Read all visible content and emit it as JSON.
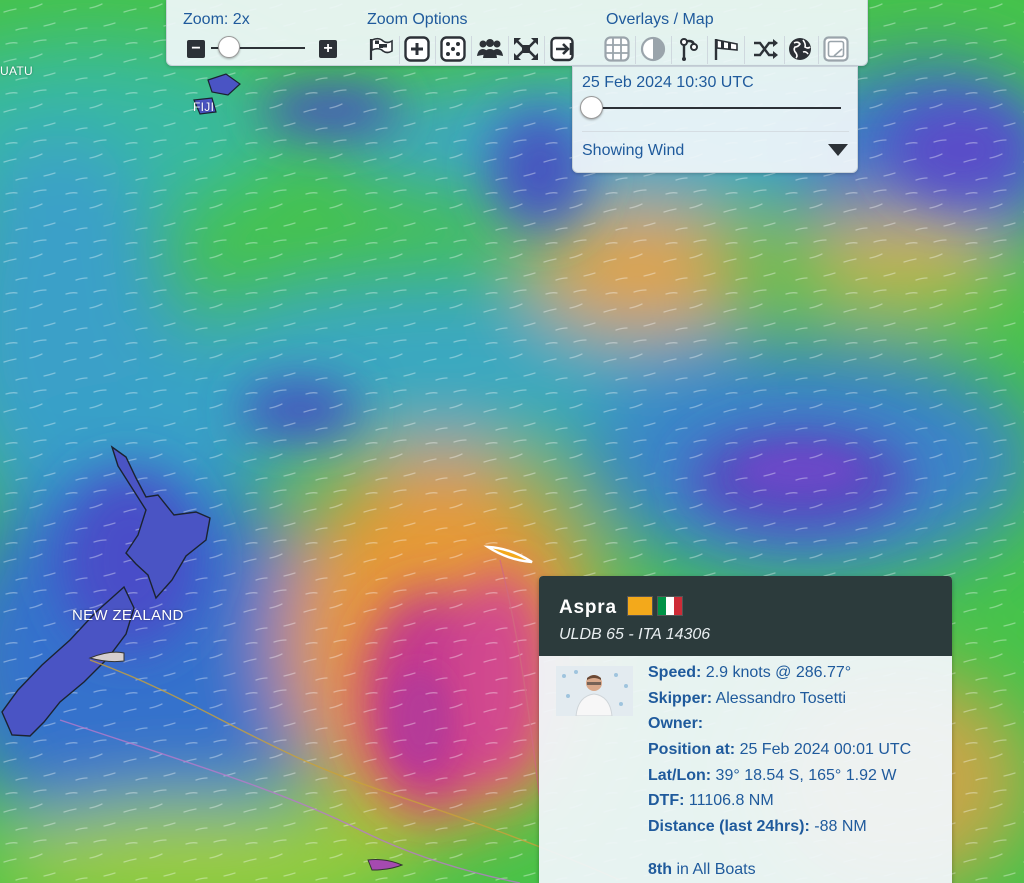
{
  "toolbar": {
    "zoom_label": "Zoom: 2x",
    "zoom_options_label": "Zoom Options",
    "overlays_label": "Overlays / Map",
    "zoom_out_glyph": "−",
    "zoom_in_glyph": "+",
    "icons": [
      "flag-icon",
      "zoom-in-square-icon",
      "dice-icon",
      "group-icon",
      "fit-expand-icon",
      "exit-arrow-icon",
      "grid-icon",
      "contrast-icon",
      "fork-icon",
      "wind-flag-icon",
      "shuffle-icon",
      "globe-icon",
      "map-frame-icon"
    ]
  },
  "time_panel": {
    "datetime": "25 Feb 2024 10:30 UTC",
    "layer": "Showing Wind"
  },
  "map": {
    "labels": {
      "new_zealand": "NEW ZEALAND",
      "fiji": "FIJI",
      "vanuatu": "UATU"
    }
  },
  "boat": {
    "name": "Aspra",
    "class": "ULDB 65 - ITA 14306",
    "speed_label": "Speed:",
    "speed_value": "2.9 knots @ 286.77°",
    "skipper_label": "Skipper:",
    "skipper_value": "Alessandro Tosetti",
    "owner_label": "Owner:",
    "owner_value": "",
    "position_label": "Position at:",
    "position_value": "25 Feb 2024 00:01 UTC",
    "latlon_label": "Lat/Lon:",
    "latlon_value": "39° 18.54 S, 165° 1.92 W",
    "dtf_label": "DTF:",
    "dtf_value": "11106.8 NM",
    "distance_label": "Distance (last 24hrs):",
    "distance_value": "-88 NM",
    "rank_value": "8th",
    "rank_text": "in All Boats",
    "flag_colors": {
      "team": "#f3a91b",
      "italy": [
        "#009246",
        "#ffffff",
        "#ce2b37"
      ]
    }
  },
  "colors": {
    "ui_blue": "#1f5a9c",
    "card_header": "#2c3b3c",
    "wind_calm": "#3a46b8",
    "wind_light": "#2f9be0",
    "wind_moderate": "#40c040",
    "wind_strong": "#e8a23a",
    "wind_gale": "#b33a8e"
  }
}
